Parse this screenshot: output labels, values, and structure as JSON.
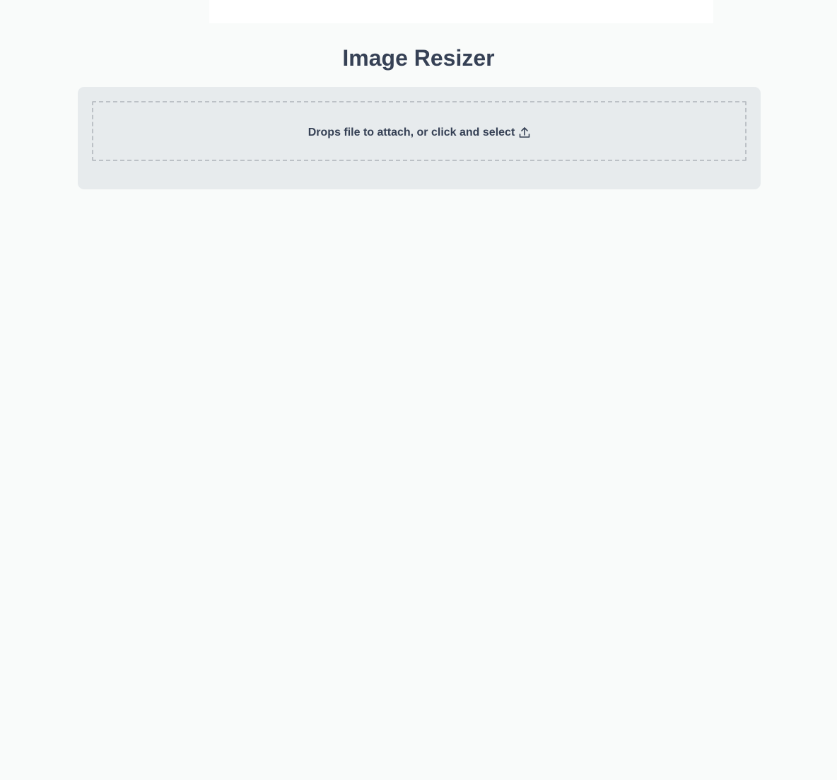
{
  "header": {
    "title": "Image Resizer"
  },
  "upload": {
    "prompt": "Drops file to attach, or click and select",
    "icon": "upload-icon"
  },
  "colors": {
    "background": "#f9fbfa",
    "panel": "#e7ebed",
    "text": "#364155",
    "dashed_border": "#bcc1c6"
  }
}
